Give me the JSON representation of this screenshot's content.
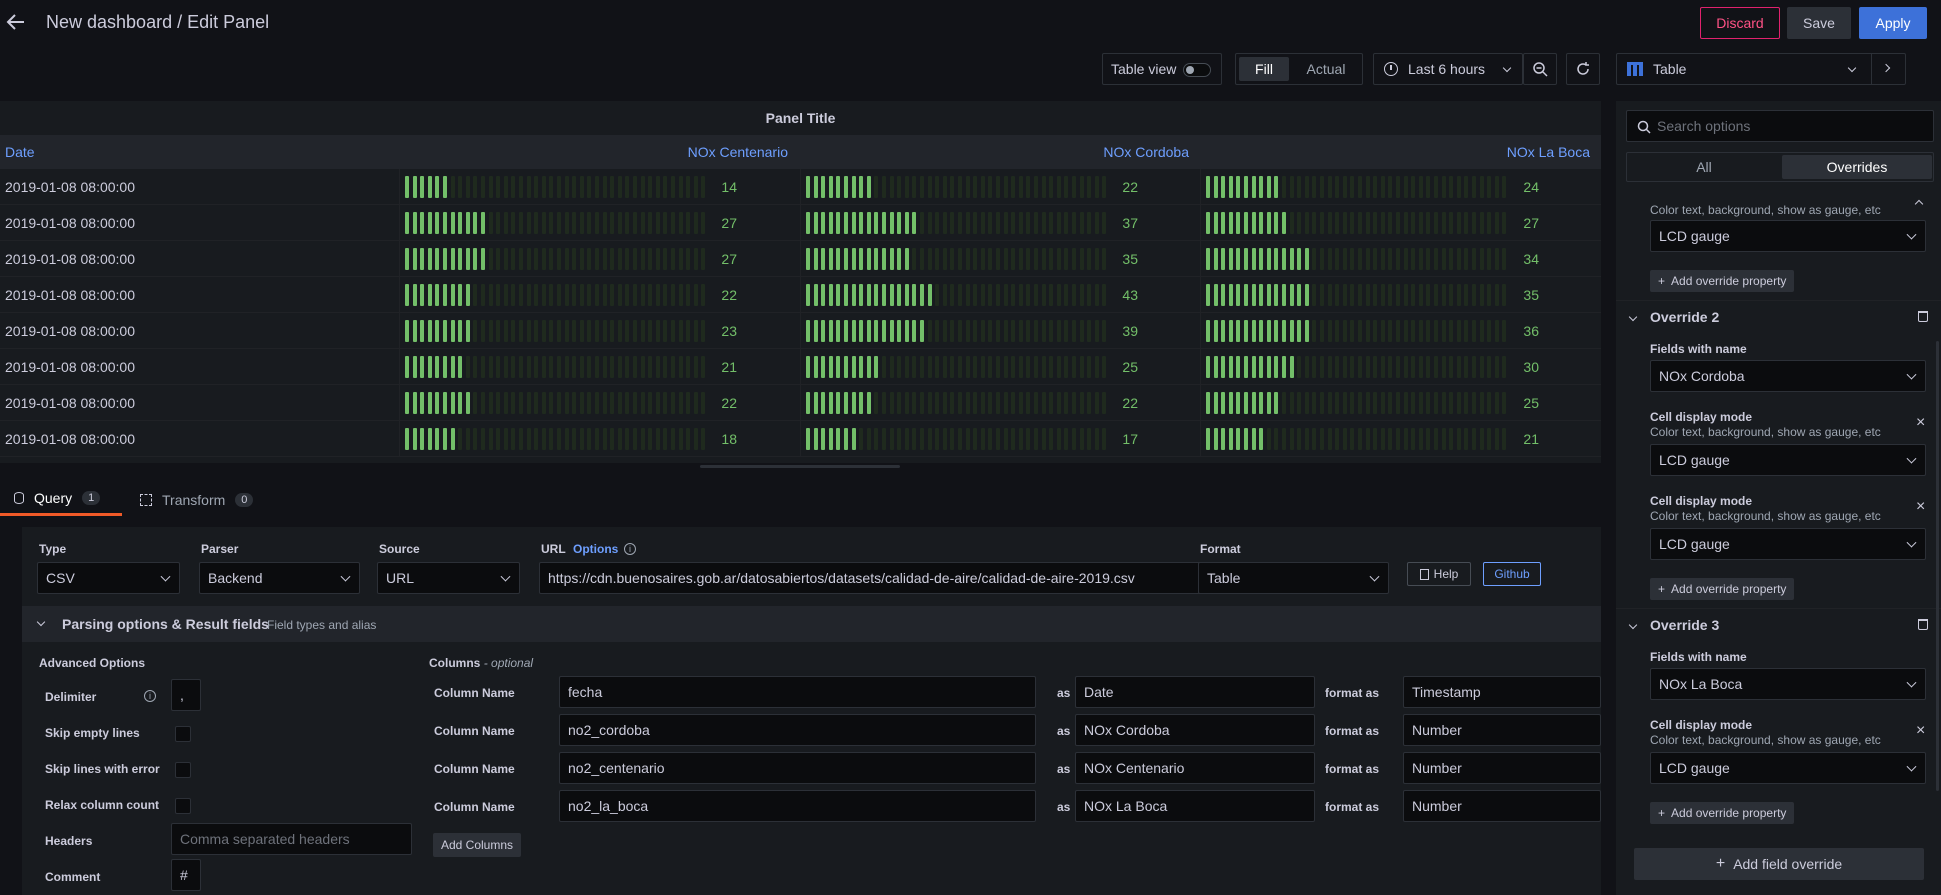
{
  "header": {
    "title": "New dashboard / Edit Panel",
    "discard": "Discard",
    "save": "Save",
    "apply": "Apply"
  },
  "toolbar": {
    "table_view": "Table view",
    "fill": "Fill",
    "actual": "Actual",
    "time_range": "Last 6 hours",
    "viz": "Table"
  },
  "panel": {
    "title": "Panel Title",
    "columns": [
      "Date",
      "NOx Centenario",
      "NOx Cordoba",
      "NOx La Boca"
    ],
    "rows": [
      {
        "date": "2019-01-08 08:00:00",
        "v": [
          14,
          22,
          24
        ]
      },
      {
        "date": "2019-01-08 08:00:00",
        "v": [
          27,
          37,
          27
        ]
      },
      {
        "date": "2019-01-08 08:00:00",
        "v": [
          27,
          35,
          34
        ]
      },
      {
        "date": "2019-01-08 08:00:00",
        "v": [
          22,
          43,
          35
        ]
      },
      {
        "date": "2019-01-08 08:00:00",
        "v": [
          23,
          39,
          36
        ]
      },
      {
        "date": "2019-01-08 08:00:00",
        "v": [
          21,
          25,
          30
        ]
      },
      {
        "date": "2019-01-08 08:00:00",
        "v": [
          22,
          22,
          25
        ]
      },
      {
        "date": "2019-01-08 08:00:00",
        "v": [
          18,
          17,
          21
        ]
      }
    ],
    "gauge_max": 100
  },
  "tabs": {
    "query": "Query",
    "query_count": "1",
    "transform": "Transform",
    "transform_count": "0"
  },
  "query": {
    "type_label": "Type",
    "type_value": "CSV",
    "parser_label": "Parser",
    "parser_value": "Backend",
    "source_label": "Source",
    "source_value": "URL",
    "url_label": "URL",
    "url_options": "Options",
    "url_value": "https://cdn.buenosaires.gob.ar/datosabiertos/datasets/calidad-de-aire/calidad-de-aire-2019.csv",
    "format_label": "Format",
    "format_value": "Table",
    "help": "Help",
    "github": "Github",
    "parsing_title": "Parsing options & Result fields",
    "parsing_sub": "Field types and alias",
    "advanced_title": "Advanced Options",
    "delimiter_label": "Delimiter",
    "delimiter_value": ",",
    "skip_empty": "Skip empty lines",
    "skip_error": "Skip lines with error",
    "relax": "Relax column count",
    "headers_label": "Headers",
    "headers_placeholder": "Comma separated headers",
    "comment_label": "Comment",
    "comment_value": "#",
    "columns_title": "Columns",
    "columns_optional": "- optional",
    "col_name_label": "Column Name",
    "as": "as",
    "format_as": "format as",
    "columns": [
      {
        "name": "fecha",
        "alias": "Date",
        "type": "Timestamp"
      },
      {
        "name": "no2_cordoba",
        "alias": "NOx Cordoba",
        "type": "Number"
      },
      {
        "name": "no2_centenario",
        "alias": "NOx Centenario",
        "type": "Number"
      },
      {
        "name": "no2_la_boca",
        "alias": "NOx La Boca",
        "type": "Number"
      }
    ],
    "add_columns": "Add Columns"
  },
  "options": {
    "search_placeholder": "Search options",
    "tab_all": "All",
    "tab_overrides": "Overrides",
    "o1_desc": "Color text, background, show as gauge, etc",
    "o1_value": "LCD gauge",
    "add_prop": "Add override property",
    "o2_title": "Override 2",
    "fields_with_name": "Fields with name",
    "o2_field": "NOx Cordoba",
    "cell_mode": "Cell display mode",
    "cell_desc": "Color text, background, show as gauge, etc",
    "lcd": "LCD gauge",
    "o3_title": "Override 3",
    "o3_field": "NOx La Boca",
    "add_field_override": "Add field override"
  }
}
